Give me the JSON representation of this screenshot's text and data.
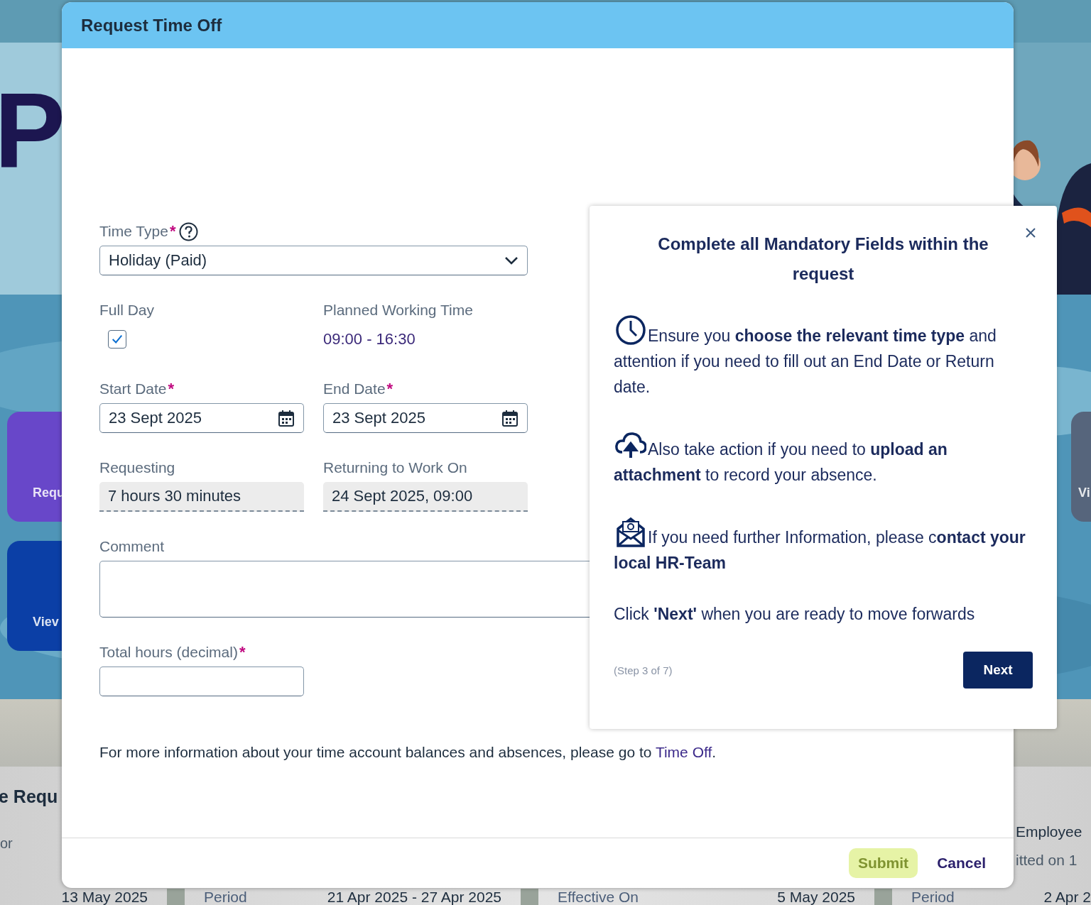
{
  "background_page": {
    "banner_text": "P",
    "tiles": [
      {
        "label": "Requ",
        "color": "#6847c9"
      },
      {
        "label": "Viev",
        "color": "#0b3fa6"
      },
      {
        "label": "Vi",
        "color": "#56657c"
      }
    ],
    "section_title": "e Requ",
    "section_subtitle": "or",
    "side_texts": [
      "Employee",
      "itted on 1"
    ],
    "cards": [
      {
        "value": "13 May 2025"
      },
      {
        "label": "Period",
        "value": "21 Apr 2025 - 27 Apr 2025"
      },
      {
        "label": "Effective On",
        "value": "5 May 2025"
      },
      {
        "label": "Period",
        "value": "2 Apr 2"
      }
    ]
  },
  "dialog": {
    "title": "Request Time Off",
    "required_marker": "*",
    "fields": [
      {
        "kind": "select",
        "label": "Time Type",
        "required": true,
        "help": true,
        "value": "Holiday (Paid)"
      },
      {
        "kind": "checkbox",
        "label": "Full Day",
        "required": false,
        "checked": true
      },
      {
        "kind": "text",
        "label": "Planned Working Time",
        "required": false,
        "value": "09:00 - 16:30"
      },
      {
        "kind": "date",
        "label": "Start Date",
        "required": true,
        "value": "23 Sept 2025"
      },
      {
        "kind": "date",
        "label": "End Date",
        "required": true,
        "value": "23 Sept 2025"
      },
      {
        "kind": "readonly",
        "label": "Requesting",
        "required": false,
        "value": "7 hours 30 minutes"
      },
      {
        "kind": "readonly",
        "label": "Returning to Work On",
        "required": false,
        "value": "24 Sept 2025, 09:00"
      },
      {
        "kind": "textarea",
        "label": "Comment",
        "required": false
      },
      {
        "kind": "input",
        "label": "Total hours (decimal)",
        "required": true
      }
    ],
    "info": {
      "text": "For more information about your time account balances and absences, please go to ",
      "link": "Time Off",
      "end": "."
    },
    "buttons": [
      {
        "label": "Submit",
        "kind": "primary",
        "disabled": true
      },
      {
        "label": "Cancel",
        "kind": "plain",
        "disabled": false
      }
    ]
  },
  "tour": {
    "title": "Complete all Mandatory Fields within the request",
    "items": [
      {
        "text": "Ensure you **choose the relevant time type** and attention if you need to fill out an End Date or Return date."
      },
      {
        "text": "Also take action if you need to **upload an attachment** to record your absence."
      },
      {
        "text": "If you need further Information, please c**ontact your local HR-Team**"
      }
    ],
    "closing": "Click **'Next'** when you are ready to move forwards",
    "step": "(Step 3 of 7)",
    "next_button": "Next"
  }
}
